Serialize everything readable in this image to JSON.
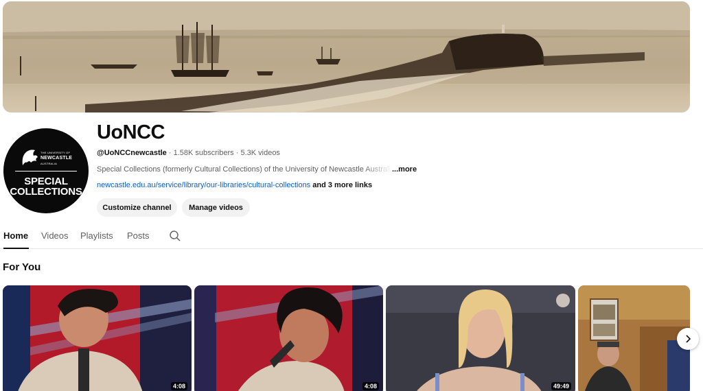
{
  "channel": {
    "title": "UoNCC",
    "handle": "@UoNCCnewcastle",
    "subscribers": "1.58K subscribers",
    "videos": "5.3K videos",
    "separator": "·",
    "description": "Special Collections (formerly Cultural Collections) of the University of Newcastle Australia",
    "description_more": "...more",
    "link": "newcastle.edu.au/service/library/our-libraries/cultural-collections",
    "more_links": "and 3 more links",
    "avatar": {
      "uni_line1": "THE UNIVERSITY OF",
      "uni_line2": "NEWCASTLE",
      "uni_line3": "AUSTRALIA",
      "line1": "SPECIAL",
      "line2": "COLLECTIONS"
    }
  },
  "buttons": {
    "customize": "Customize channel",
    "manage": "Manage videos"
  },
  "tabs": [
    {
      "label": "Home",
      "active": true
    },
    {
      "label": "Videos",
      "active": false
    },
    {
      "label": "Playlists",
      "active": false
    },
    {
      "label": "Posts",
      "active": false
    }
  ],
  "section": {
    "title": "For You"
  },
  "videos": [
    {
      "duration": "4:08",
      "progress": 0.0
    },
    {
      "duration": "4:08",
      "progress": 0.0
    },
    {
      "duration": "49:49",
      "progress": 0.0
    },
    {
      "duration": "",
      "progress": 0.0
    }
  ],
  "colors": {
    "accent_link": "#065fd4",
    "text_primary": "#0f0f0f",
    "text_secondary": "#606060",
    "button_bg": "#f2f2f2"
  },
  "icons": {
    "search": "search-icon",
    "next": "chevron-right-icon"
  }
}
